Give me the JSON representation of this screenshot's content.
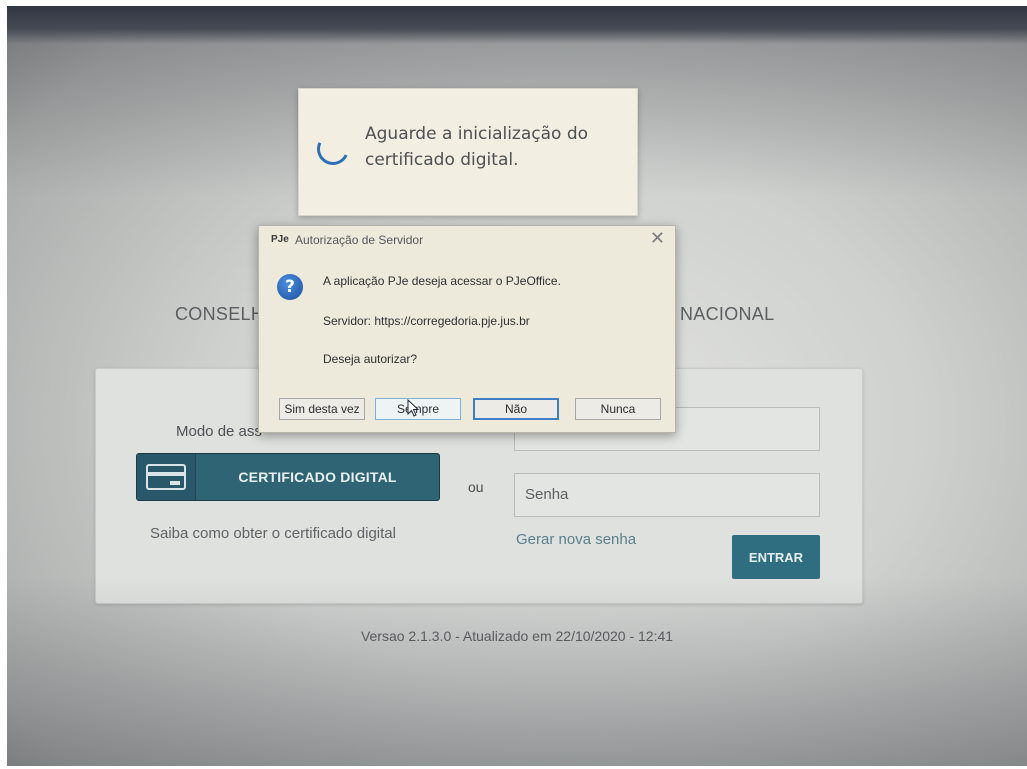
{
  "login_page": {
    "org_title_left": "CONSELH",
    "org_title_right": "NACIONAL",
    "mode_label": "Modo de ass",
    "certificate_button": "CERTIFICADO DIGITAL",
    "or_text": "ou",
    "certificate_help_link": "Saiba como obter o certificado digital",
    "password_placeholder": "Senha",
    "new_password_link": "Gerar nova senha",
    "login_button": "ENTRAR",
    "version": "Versao 2.1.3.0 - Atualizado em 22/10/2020 - 12:41"
  },
  "loading_toast": {
    "message": "Aguarde a inicialização do certificado digital."
  },
  "auth_dialog": {
    "logo_text": "PJe",
    "title": "Autorização de Servidor",
    "line_1": "A aplicação PJe deseja acessar o PJeOffice.",
    "line_2": "Servidor: https://corregedoria.pje.jus.br",
    "line_3": "Deseja autorizar?",
    "buttons": {
      "once": "Sim desta vez",
      "always": "Sempre",
      "no": "Não",
      "never": "Nunca"
    },
    "close_glyph": "✕"
  },
  "colors": {
    "certificate_button": "#2e6474",
    "login_button": "#2f6e80",
    "dialog_background": "#ede9db",
    "spinner": "#2a6fb8"
  },
  "icons": [
    "spinner-icon",
    "question-icon",
    "credit-card-icon",
    "close-icon",
    "mouse-pointer-icon"
  ]
}
